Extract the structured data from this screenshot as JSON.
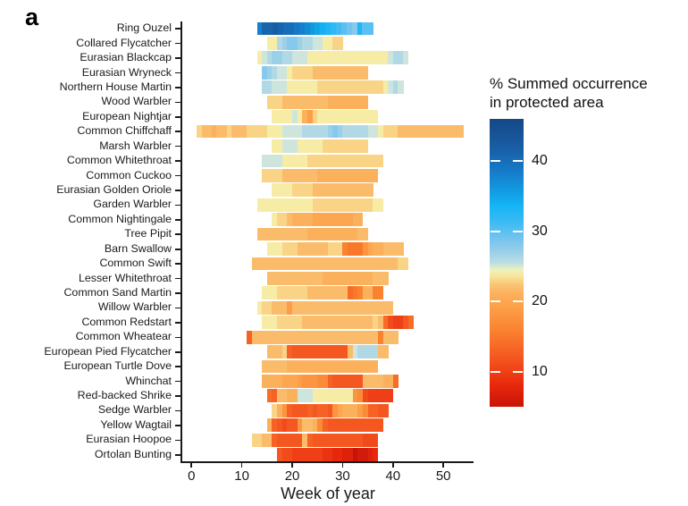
{
  "panel": {
    "label": "a"
  },
  "legend": {
    "title_line1": "% Summed occurrence",
    "title_line2": "in protected area",
    "ticks": [
      {
        "value": 40,
        "label": "40"
      },
      {
        "value": 30,
        "label": "30"
      },
      {
        "value": 20,
        "label": "20"
      },
      {
        "value": 10,
        "label": "10"
      }
    ],
    "vmin": 5,
    "vmax": 46,
    "colors": {
      "red": "#ee2b10",
      "orange": "#f98020",
      "pale_yellow": "#f5f0a8",
      "pale_blue": "#a8d4e8",
      "cyan": "#14b4f0",
      "blue": "#1a78c8",
      "dark_blue": "#19548e"
    }
  },
  "chart_data": {
    "type": "heatmap",
    "title": "",
    "xlabel": "Week of year",
    "ylabel": "",
    "xlim": [
      -2,
      56
    ],
    "xticks": [
      0,
      10,
      20,
      30,
      40,
      50
    ],
    "xticklabels": [
      "0",
      "10",
      "20",
      "30",
      "40",
      "50"
    ],
    "grid": false,
    "legend_position": "right",
    "colorbar": {
      "label": "% Summed occurrence in protected area",
      "vmin": 5,
      "vmax": 46,
      "ticks": [
        10,
        20,
        30,
        40
      ]
    },
    "value_unit": "%",
    "x_unit": "week",
    "categories": [
      "Ring Ouzel",
      "Collared Flycatcher",
      "Eurasian Blackcap",
      "Eurasian Wryneck",
      "Northern House Martin",
      "Wood Warbler",
      "European Nightjar",
      "Common Chiffchaff",
      "Marsh Warbler",
      "Common Whitethroat",
      "Common Cuckoo",
      "Eurasian Golden Oriole",
      "Garden Warbler",
      "Common Nightingale",
      "Tree Pipit",
      "Barn Swallow",
      "Common Swift",
      "Lesser Whitethroat",
      "Common Sand Martin",
      "Willow Warbler",
      "Common Redstart",
      "Common Wheatear",
      "European Pied Flycatcher",
      "European Turtle Dove",
      "Whinchat",
      "Red-backed Shrike",
      "Sedge Warbler",
      "Yellow Wagtail",
      "Eurasian Hoopoe",
      "Ortolan Bunting"
    ],
    "rows": [
      {
        "species": "Ring Ouzel",
        "week_start": 13,
        "week_end": 35,
        "values": [
          38,
          41,
          41,
          42,
          41,
          40,
          40,
          39,
          38,
          37,
          36,
          35,
          34,
          33,
          32,
          31,
          30,
          29,
          28,
          33,
          30,
          30
        ]
      },
      {
        "species": "Collared Flycatcher",
        "week_start": 15,
        "week_end": 29,
        "values": [
          24,
          24,
          26,
          27,
          28,
          28,
          27,
          26,
          26,
          25,
          25,
          24,
          24,
          23,
          23
        ]
      },
      {
        "species": "Eurasian Blackcap",
        "week_start": 13,
        "week_end": 42,
        "values": [
          24,
          25,
          26,
          27,
          27,
          26,
          26,
          25,
          25,
          25,
          24,
          24,
          24,
          24,
          24,
          24,
          24,
          24,
          24,
          24,
          24,
          24,
          24,
          24,
          24,
          24,
          25,
          26,
          26,
          25
        ]
      },
      {
        "species": "Eurasian Wryneck",
        "week_start": 14,
        "week_end": 34,
        "values": [
          28,
          27,
          26,
          25,
          25,
          24,
          23,
          23,
          23,
          23,
          22,
          22,
          22,
          22,
          22,
          22,
          22,
          22,
          22,
          22,
          22
        ]
      },
      {
        "species": "Northern House Martin",
        "week_start": 14,
        "week_end": 41,
        "values": [
          26,
          26,
          25,
          25,
          25,
          24,
          24,
          24,
          24,
          24,
          24,
          23,
          23,
          23,
          23,
          23,
          23,
          23,
          23,
          23,
          23,
          23,
          23,
          23,
          24,
          25,
          26,
          25
        ]
      },
      {
        "species": "Wood Warbler",
        "week_start": 15,
        "week_end": 34,
        "values": [
          23,
          23,
          23,
          22,
          22,
          22,
          22,
          22,
          22,
          22,
          22,
          22,
          21,
          21,
          21,
          21,
          21,
          21,
          21,
          21
        ]
      },
      {
        "species": "European Nightjar",
        "week_start": 16,
        "week_end": 36,
        "values": [
          24,
          24,
          24,
          24,
          25,
          24,
          21,
          19,
          23,
          24,
          24,
          24,
          24,
          24,
          24,
          24,
          24,
          24,
          24,
          24,
          24
        ]
      },
      {
        "species": "Common Chiffchaff",
        "week_start": 1,
        "week_end": 53,
        "values": [
          23,
          22,
          22,
          21,
          22,
          22,
          23,
          22,
          22,
          22,
          23,
          23,
          23,
          23,
          24,
          24,
          24,
          25,
          25,
          25,
          25,
          26,
          26,
          26,
          26,
          26,
          27,
          28,
          27,
          26,
          26,
          26,
          26,
          26,
          25,
          25,
          24,
          23,
          23,
          23,
          22,
          22,
          22,
          22,
          22,
          22,
          22,
          22,
          22,
          22,
          22,
          22,
          22
        ]
      },
      {
        "species": "Marsh Warbler",
        "week_start": 16,
        "week_end": 34,
        "values": [
          24,
          24,
          25,
          25,
          25,
          24,
          24,
          24,
          24,
          24,
          23,
          23,
          23,
          23,
          23,
          23,
          23,
          23,
          23
        ]
      },
      {
        "species": "Common Whitethroat",
        "week_start": 14,
        "week_end": 37,
        "values": [
          25,
          25,
          25,
          25,
          24,
          24,
          24,
          24,
          24,
          23,
          23,
          23,
          23,
          23,
          23,
          23,
          23,
          23,
          23,
          23,
          23,
          23,
          23,
          23
        ]
      },
      {
        "species": "Common Cuckoo",
        "week_start": 14,
        "week_end": 36,
        "values": [
          23,
          23,
          23,
          23,
          22,
          22,
          22,
          22,
          22,
          22,
          22,
          21,
          21,
          21,
          21,
          21,
          21,
          21,
          21,
          21,
          21,
          21,
          21
        ]
      },
      {
        "species": "Eurasian Golden Oriole",
        "week_start": 16,
        "week_end": 35,
        "values": [
          24,
          24,
          24,
          24,
          23,
          23,
          23,
          23,
          22,
          22,
          22,
          22,
          22,
          22,
          22,
          22,
          22,
          22,
          22,
          22
        ]
      },
      {
        "species": "Garden Warbler",
        "week_start": 13,
        "week_end": 37,
        "values": [
          24,
          24,
          24,
          24,
          24,
          24,
          24,
          24,
          24,
          24,
          24,
          23,
          23,
          23,
          23,
          23,
          23,
          23,
          23,
          23,
          23,
          23,
          23,
          24,
          24
        ]
      },
      {
        "species": "Common Nightingale",
        "week_start": 16,
        "week_end": 33,
        "values": [
          24,
          23,
          23,
          22,
          21,
          21,
          21,
          21,
          20,
          20,
          20,
          20,
          20,
          20,
          20,
          20,
          21,
          21
        ]
      },
      {
        "species": "Tree Pipit",
        "week_start": 13,
        "week_end": 34,
        "values": [
          22,
          22,
          22,
          22,
          22,
          22,
          22,
          22,
          22,
          22,
          21,
          21,
          21,
          21,
          21,
          21,
          21,
          21,
          21,
          21,
          22,
          22
        ]
      },
      {
        "species": "Barn Swallow",
        "week_start": 15,
        "week_end": 41,
        "values": [
          24,
          24,
          24,
          23,
          23,
          23,
          22,
          22,
          22,
          22,
          22,
          22,
          23,
          23,
          23,
          16,
          15,
          15,
          15,
          18,
          20,
          21,
          21,
          22,
          22,
          22,
          22
        ]
      },
      {
        "species": "Common Swift",
        "week_start": 12,
        "week_end": 42,
        "values": [
          22,
          22,
          22,
          22,
          22,
          22,
          22,
          22,
          22,
          22,
          22,
          22,
          22,
          22,
          22,
          22,
          22,
          22,
          22,
          22,
          22,
          22,
          22,
          22,
          22,
          22,
          22,
          22,
          22,
          23,
          23
        ]
      },
      {
        "species": "Lesser Whitethroat",
        "week_start": 15,
        "week_end": 38,
        "values": [
          22,
          22,
          22,
          22,
          22,
          22,
          22,
          22,
          22,
          22,
          22,
          21,
          21,
          21,
          21,
          21,
          21,
          21,
          21,
          21,
          21,
          22,
          22,
          22
        ]
      },
      {
        "species": "Common Sand Martin",
        "week_start": 14,
        "week_end": 37,
        "values": [
          24,
          24,
          24,
          23,
          23,
          23,
          23,
          23,
          23,
          22,
          22,
          22,
          22,
          22,
          22,
          22,
          22,
          14,
          15,
          16,
          21,
          21,
          16,
          16
        ]
      },
      {
        "species": "Willow Warbler",
        "week_start": 13,
        "week_end": 39,
        "values": [
          24,
          23,
          23,
          22,
          22,
          22,
          19,
          22,
          22,
          22,
          22,
          22,
          22,
          22,
          22,
          22,
          22,
          22,
          22,
          22,
          22,
          22,
          22,
          22,
          22,
          22,
          22
        ]
      },
      {
        "species": "Common Redstart",
        "week_start": 14,
        "week_end": 43,
        "values": [
          24,
          24,
          24,
          23,
          23,
          23,
          23,
          23,
          22,
          22,
          22,
          22,
          22,
          22,
          22,
          22,
          22,
          22,
          22,
          22,
          22,
          22,
          23,
          22,
          14,
          11,
          10,
          10,
          12,
          14
        ]
      },
      {
        "species": "Common Wheatear",
        "week_start": 11,
        "week_end": 40,
        "values": [
          13,
          22,
          22,
          22,
          22,
          22,
          22,
          22,
          22,
          22,
          22,
          22,
          22,
          22,
          22,
          22,
          22,
          22,
          22,
          22,
          22,
          22,
          22,
          22,
          22,
          22,
          16,
          22,
          22,
          22
        ]
      },
      {
        "species": "European Pied Flycatcher",
        "week_start": 15,
        "week_end": 38,
        "values": [
          22,
          22,
          22,
          23,
          13,
          12,
          12,
          12,
          12,
          12,
          12,
          12,
          12,
          12,
          12,
          12,
          22,
          25,
          26,
          26,
          26,
          26,
          22,
          22
        ]
      },
      {
        "species": "European Turtle Dove",
        "week_start": 14,
        "week_end": 36,
        "values": [
          22,
          22,
          22,
          22,
          22,
          21,
          21,
          21,
          21,
          21,
          21,
          21,
          21,
          21,
          21,
          21,
          21,
          21,
          21,
          21,
          21,
          21,
          21
        ]
      },
      {
        "species": "Whinchat",
        "week_start": 14,
        "week_end": 40,
        "values": [
          21,
          21,
          21,
          21,
          20,
          20,
          20,
          19,
          18,
          18,
          18,
          17,
          17,
          13,
          12,
          12,
          12,
          12,
          12,
          12,
          22,
          22,
          22,
          22,
          21,
          21,
          14
        ]
      },
      {
        "species": "Red-backed Shrike",
        "week_start": 15,
        "week_end": 39,
        "values": [
          14,
          13,
          22,
          22,
          21,
          21,
          25,
          25,
          25,
          24,
          24,
          24,
          24,
          24,
          24,
          24,
          24,
          18,
          17,
          11,
          10,
          10,
          10,
          10,
          10
        ]
      },
      {
        "species": "Sedge Warbler",
        "week_start": 16,
        "week_end": 38,
        "values": [
          23,
          21,
          18,
          13,
          12,
          12,
          12,
          13,
          12,
          13,
          13,
          12,
          18,
          20,
          21,
          21,
          21,
          19,
          17,
          13,
          13,
          12,
          12
        ]
      },
      {
        "species": "Yellow Wagtail",
        "week_start": 15,
        "week_end": 37,
        "values": [
          21,
          13,
          12,
          11,
          12,
          12,
          18,
          22,
          22,
          21,
          17,
          13,
          12,
          12,
          12,
          12,
          12,
          12,
          12,
          12,
          12,
          12,
          12
        ]
      },
      {
        "species": "Eurasian Hoopoe",
        "week_start": 12,
        "week_end": 36,
        "values": [
          23,
          23,
          22,
          22,
          13,
          12,
          12,
          12,
          12,
          12,
          22,
          13,
          12,
          12,
          12,
          12,
          12,
          12,
          12,
          12,
          12,
          12,
          11,
          11,
          11
        ]
      },
      {
        "species": "Ortolan Bunting",
        "week_start": 17,
        "week_end": 36,
        "values": [
          12,
          11,
          11,
          10,
          10,
          10,
          10,
          10,
          10,
          9,
          9,
          8,
          8,
          7,
          7,
          5,
          6,
          6,
          7,
          8
        ]
      }
    ]
  }
}
